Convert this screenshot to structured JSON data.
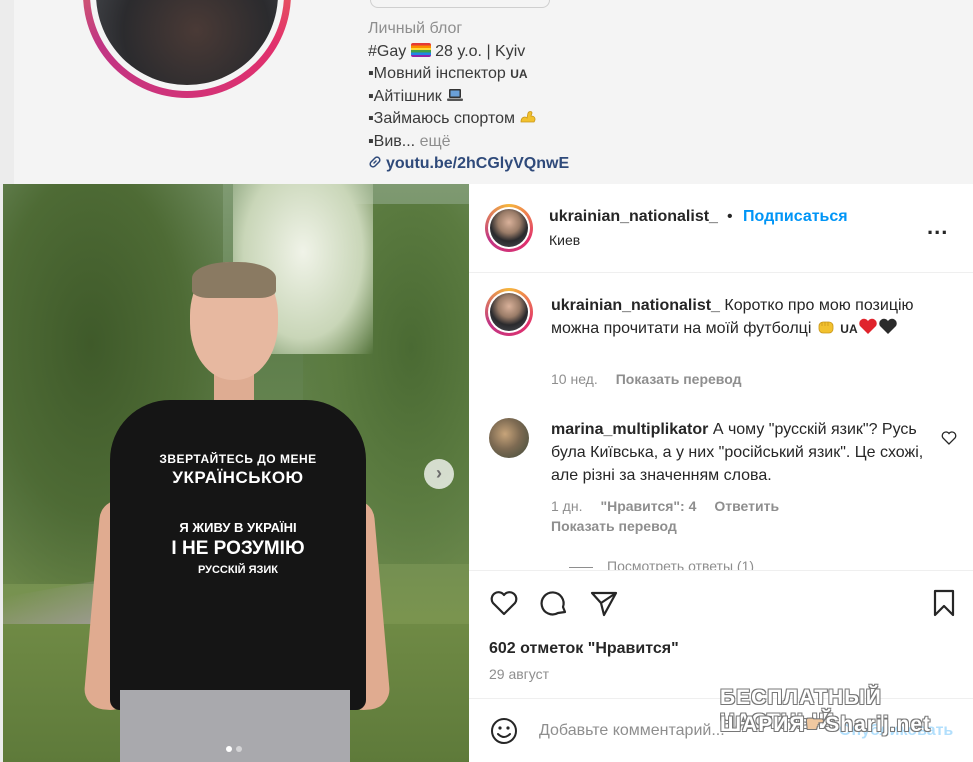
{
  "profile": {
    "category": "Личный блог",
    "bio_lines": [
      "#Gay",
      " 28 y.o. | Kyiv",
      "▪Мовний інспектор",
      "UA",
      "▪Айтішник",
      "▪Займаюсь спортом",
      "▪Вив...",
      "ещё"
    ],
    "link": "youtu.be/2hCGlyVQnwE"
  },
  "post_image": {
    "shirt_lines": [
      "ЗВЕРТАЙТЕСЬ ДО МЕНЕ",
      "УКРАЇНСЬКОЮ",
      "Я ЖИВУ В УКРАЇНІ",
      "І НЕ РОЗУМІЮ",
      "РУССКІЙ ЯЗИК"
    ],
    "next_icon": "chevron-right-icon",
    "carousel_position": 1,
    "carousel_total": 2
  },
  "post_header": {
    "username": "ukrainian_nationalist_",
    "separator": "•",
    "follow_label": "Подписаться",
    "location": "Киев",
    "more_icon": "ellipsis-icon"
  },
  "caption": {
    "username": "ukrainian_nationalist_",
    "text": "Коротко про мою позицію можна прочитати на моїй футболці",
    "flag_text": "UA",
    "time": "10 нед.",
    "translate_label": "Показать перевод"
  },
  "comments": [
    {
      "username": "marina_multiplikator",
      "text": "А чому \"русскій язик\"? Русь була Київська, а у них \"російський язик\". Це схожі, але різні за значенням слова.",
      "time": "1 дн.",
      "likes": "\"Нравится\": 4",
      "reply_label": "Ответить",
      "translate_label": "Показать перевод",
      "view_replies": "Посмотреть ответы (1)"
    }
  ],
  "actions": {
    "like_icon": "heart-icon",
    "comment_icon": "comment-icon",
    "share_icon": "send-icon",
    "save_icon": "bookmark-icon"
  },
  "likes_text": "602 отметок \"Нравится\"",
  "date_text": "29 август",
  "add_comment": {
    "emoji_icon": "smiley-icon",
    "placeholder": "Добавьте комментарий...",
    "publish_label": "Опубликовать"
  },
  "watermark": {
    "line1": "БЕСПЛАТНЫЙ ЧАСТНЫЙ",
    "line2": "ШАРИЯ",
    "line2b": "Sharij.net"
  },
  "colors": {
    "accent": "#0095f6",
    "text": "#262626",
    "muted": "#8e8e8e"
  }
}
